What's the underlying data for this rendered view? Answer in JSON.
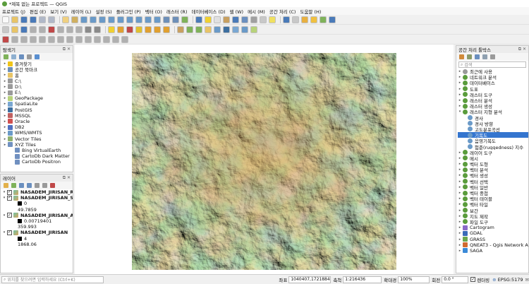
{
  "window": {
    "title": "*제목 없는 프로젝트 — QGIS"
  },
  "menu": [
    "프로젝트 (J)",
    "편집 (E)",
    "보기 (V)",
    "레이어 (L)",
    "설정 (S)",
    "플러그인 (P)",
    "벡터 (O)",
    "래스터 (R)",
    "데이터베이스 (D)",
    "웹 (W)",
    "메시 (M)",
    "공간 처리 (C)",
    "도움말 (H)"
  ],
  "browser": {
    "title": "탐색기",
    "items": [
      {
        "label": "즐겨찾기",
        "icon": "star-icon",
        "color": "#f0c419",
        "indent": 0
      },
      {
        "label": "공간 북마크",
        "icon": "bookmark-icon",
        "color": "#6d8fb8",
        "indent": 0
      },
      {
        "label": "홈",
        "icon": "folder-icon",
        "color": "#e8c467",
        "indent": 0
      },
      {
        "label": "C:\\",
        "icon": "drive-icon",
        "color": "#9a9a9a",
        "indent": 0
      },
      {
        "label": "D:\\",
        "icon": "drive-icon",
        "color": "#9a9a9a",
        "indent": 0
      },
      {
        "label": "E:\\",
        "icon": "drive-icon",
        "color": "#9a9a9a",
        "indent": 0
      },
      {
        "label": "GeoPackage",
        "icon": "geopackage-icon",
        "color": "#b7d27a",
        "indent": 0
      },
      {
        "label": "SpatiaLite",
        "icon": "spatialite-icon",
        "color": "#7aa7d2",
        "indent": 0
      },
      {
        "label": "PostGIS",
        "icon": "postgis-icon",
        "color": "#3d6fa0",
        "indent": 0
      },
      {
        "label": "MSSQL",
        "icon": "mssql-icon",
        "color": "#c06060",
        "indent": 0
      },
      {
        "label": "Oracle",
        "icon": "oracle-icon",
        "color": "#d05050",
        "indent": 0
      },
      {
        "label": "DB2",
        "icon": "db2-icon",
        "color": "#5070c0",
        "indent": 0
      },
      {
        "label": "WMS/WMTS",
        "icon": "wms-icon",
        "color": "#6a9ac8",
        "indent": 0
      },
      {
        "label": "Vector Tiles",
        "icon": "vector-tiles-icon",
        "color": "#8fb070",
        "indent": 0
      },
      {
        "label": "XYZ Tiles",
        "icon": "xyz-tiles-icon",
        "color": "#7090c0",
        "indent": 0
      },
      {
        "label": "Bing VirtualEarth",
        "icon": "tile-grid-icon",
        "color": "#7090c0",
        "indent": 1
      },
      {
        "label": "CartoDb Dark Matter",
        "icon": "tile-grid-icon",
        "color": "#7090c0",
        "indent": 1
      },
      {
        "label": "CartoDb Positron",
        "icon": "tile-grid-icon",
        "color": "#7090c0",
        "indent": 1
      }
    ]
  },
  "layers": {
    "title": "레이어",
    "items": [
      {
        "name": "NASADEM_JIRISAN_RELI",
        "bold": true,
        "legend": []
      },
      {
        "name": "NASADEM_JIRISAN_SLP",
        "bold": true,
        "legend": [
          "0",
          "49.7859"
        ]
      },
      {
        "name": "NASADEM_JIRISAN_ASP",
        "bold": true,
        "legend": [
          "0.00719401",
          "359.993"
        ]
      },
      {
        "name": "NASADEM_JIRISAN",
        "bold": true,
        "legend": [
          "4",
          "1868.06"
        ]
      }
    ]
  },
  "toolbox": {
    "title": "공간 처리 툴박스",
    "search_placeholder": "검색",
    "items": [
      {
        "label": "최근에 사용",
        "icon": "clock-icon",
        "expanded": false,
        "indent": 0
      },
      {
        "label": "네트워크 분석",
        "icon": "qgis-icon",
        "expanded": false,
        "indent": 0
      },
      {
        "label": "데이터베이스",
        "icon": "qgis-icon",
        "expanded": false,
        "indent": 0
      },
      {
        "label": "도표",
        "icon": "qgis-icon",
        "expanded": false,
        "indent": 0
      },
      {
        "label": "래스터 도구",
        "icon": "qgis-icon",
        "expanded": false,
        "indent": 0
      },
      {
        "label": "래스터 분석",
        "icon": "qgis-icon",
        "expanded": false,
        "indent": 0
      },
      {
        "label": "래스터 생성",
        "icon": "qgis-icon",
        "expanded": false,
        "indent": 0
      },
      {
        "label": "래스터 지형 분석",
        "icon": "qgis-icon",
        "expanded": true,
        "indent": 0
      },
      {
        "label": "경사",
        "icon": "gear-icon",
        "indent": 1
      },
      {
        "label": "경사 방향",
        "icon": "gear-icon",
        "indent": 1
      },
      {
        "label": "고도분포곡선",
        "icon": "gear-icon",
        "indent": 1
      },
      {
        "label": "기복도",
        "icon": "gear-icon",
        "indent": 1,
        "selected": true
      },
      {
        "label": "음영기복도",
        "icon": "gear-icon",
        "indent": 1
      },
      {
        "label": "험준(ruggedness) 지수",
        "icon": "gear-icon",
        "indent": 1
      },
      {
        "label": "레이어 도구",
        "icon": "qgis-icon",
        "expanded": false,
        "indent": 0
      },
      {
        "label": "메시",
        "icon": "qgis-icon",
        "expanded": false,
        "indent": 0
      },
      {
        "label": "벡터 도형",
        "icon": "qgis-icon",
        "expanded": false,
        "indent": 0
      },
      {
        "label": "벡터 분석",
        "icon": "qgis-icon",
        "expanded": false,
        "indent": 0
      },
      {
        "label": "벡터 생성",
        "icon": "qgis-icon",
        "expanded": false,
        "indent": 0
      },
      {
        "label": "벡터 선택",
        "icon": "qgis-icon",
        "expanded": false,
        "indent": 0
      },
      {
        "label": "벡터 일반",
        "icon": "qgis-icon",
        "expanded": false,
        "indent": 0
      },
      {
        "label": "벡터 중첩",
        "icon": "qgis-icon",
        "expanded": false,
        "indent": 0
      },
      {
        "label": "벡터 테이블",
        "icon": "qgis-icon",
        "expanded": false,
        "indent": 0
      },
      {
        "label": "벡터 타일",
        "icon": "qgis-icon",
        "expanded": false,
        "indent": 0
      },
      {
        "label": "보간",
        "icon": "qgis-icon",
        "expanded": false,
        "indent": 0
      },
      {
        "label": "지도 제작",
        "icon": "qgis-icon",
        "expanded": false,
        "indent": 0
      },
      {
        "label": "파일 도구",
        "icon": "qgis-icon",
        "expanded": false,
        "indent": 0
      },
      {
        "label": "Cartogram",
        "icon": "cartogram-icon",
        "expanded": false,
        "indent": 0
      },
      {
        "label": "GDAL",
        "icon": "gdal-icon",
        "expanded": false,
        "indent": 0
      },
      {
        "label": "GRASS",
        "icon": "grass-icon",
        "expanded": false,
        "indent": 0
      },
      {
        "label": "QNEAT3 - Qgis Network A...",
        "icon": "qneat-icon",
        "expanded": false,
        "indent": 0
      },
      {
        "label": "SAGA",
        "icon": "saga-icon",
        "expanded": false,
        "indent": 0
      }
    ]
  },
  "status": {
    "search_placeholder": "위치를 찾으려면 입력하세요 (Ctrl+K)",
    "coord_label": "좌표",
    "coord_value": "1040407,1721884",
    "scale_label": "축척",
    "scale_value": "1:216436",
    "mag_label": "확대경",
    "mag_value": "100%",
    "rot_label": "회전",
    "rot_value": "0.0 °",
    "render_label": "렌더링",
    "crs_label": "EPSG:5179"
  },
  "colors": {
    "selection": "#3475cf",
    "qgis_green": "#5a9c3c"
  }
}
